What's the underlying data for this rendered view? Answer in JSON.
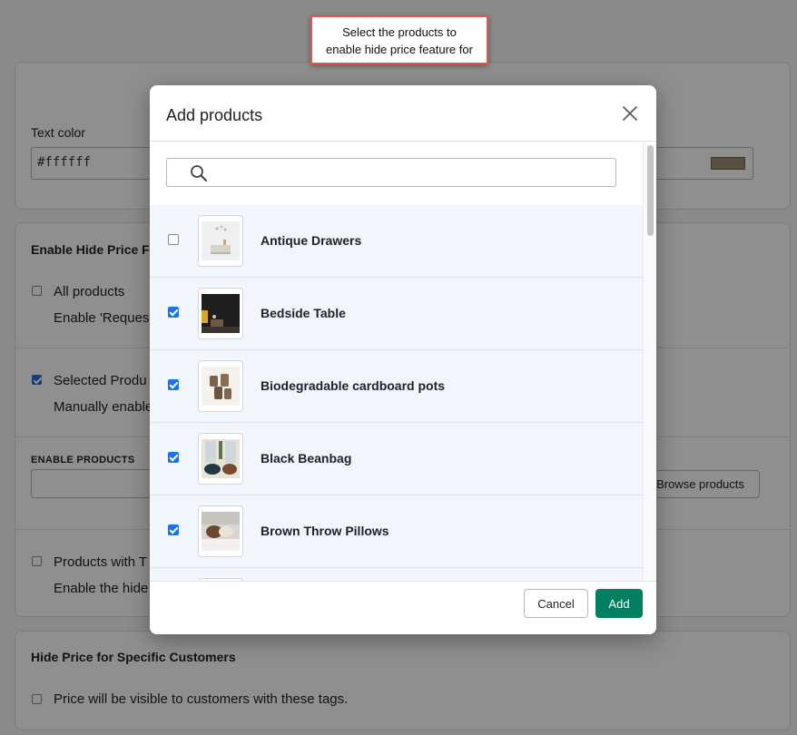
{
  "callout": {
    "line1": "Select the products to",
    "line2": "enable hide price feature for"
  },
  "background": {
    "text_color_label": "Text color",
    "text_color_value": "#ffffff",
    "enable_section_title": "Enable Hide Price F",
    "all_products_label": "All products",
    "all_products_desc": "Enable 'Reques",
    "selected_products_label": "Selected Produ",
    "selected_products_desc": "Manually enable",
    "enable_products_caption": "ENABLE PRODUCTS",
    "browse_products_button": "Browse products",
    "products_with_tags_label": "Products with T",
    "products_with_tags_desc": "Enable the hide",
    "specific_customers_title": "Hide Price for Specific Customers",
    "customer_tags_label": "Price will be visible to customers with these tags.",
    "swatch_color": "#a08c74"
  },
  "modal": {
    "title": "Add products",
    "search": {
      "placeholder": "",
      "value": ""
    },
    "products": [
      {
        "name": "Antique Drawers",
        "checked": false,
        "image": "drawers-image"
      },
      {
        "name": "Bedside Table",
        "checked": true,
        "image": "bedside-table-image"
      },
      {
        "name": "Biodegradable cardboard pots",
        "checked": true,
        "image": "cardboard-pots-image"
      },
      {
        "name": "Black Beanbag",
        "checked": true,
        "image": "beanbag-image"
      },
      {
        "name": "Brown Throw Pillows",
        "checked": true,
        "image": "pillows-image"
      }
    ],
    "cancel_label": "Cancel",
    "add_label": "Add",
    "accent_color": "#008060",
    "selected_row_color": "#f1f6fe"
  }
}
